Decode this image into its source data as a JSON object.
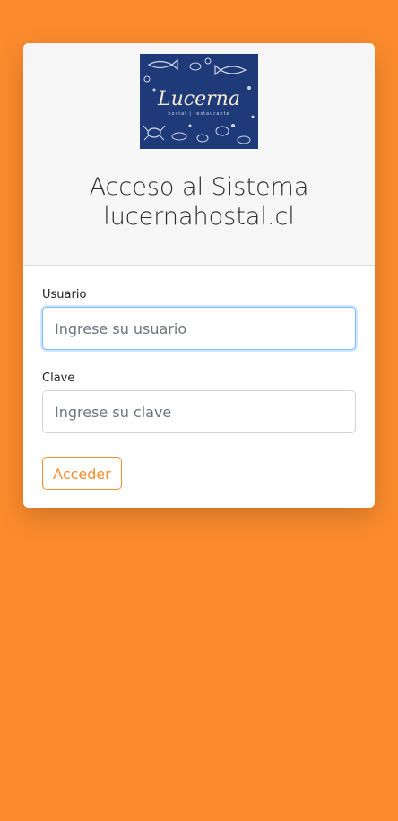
{
  "brand": {
    "logo_text": "Lucerna",
    "logo_subtext": "hostal | restaurante"
  },
  "header": {
    "title_line1": "Acceso al Sistema",
    "title_line2": "lucernahostal.cl"
  },
  "form": {
    "usuario_label": "Usuario",
    "usuario_placeholder": "Ingrese su usuario",
    "clave_label": "Clave",
    "clave_placeholder": "Ingrese su clave",
    "submit_label": "Acceder"
  },
  "colors": {
    "background": "#fb8b2d",
    "accent": "#fb8b2d",
    "logo_bg": "#1e3a78"
  }
}
